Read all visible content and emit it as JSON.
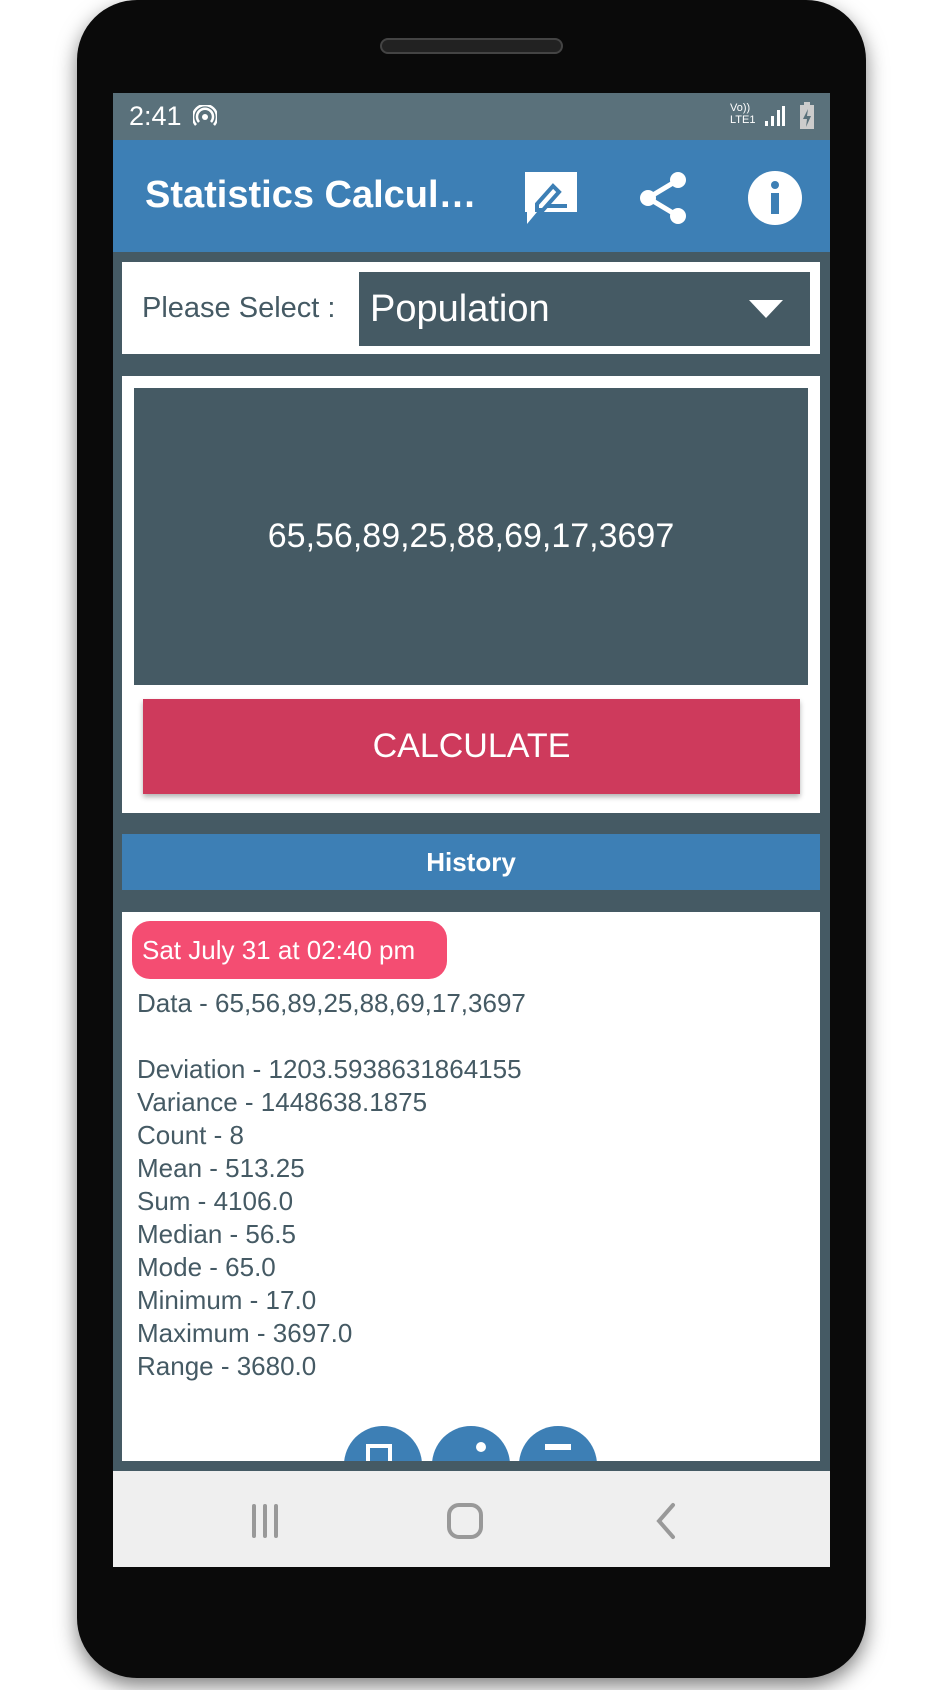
{
  "status_bar": {
    "time": "2:41",
    "network": "Vo)) LTE1"
  },
  "app_bar": {
    "title": "Statistics Calcul…",
    "icons": [
      "feedback-icon",
      "share-icon",
      "info-icon"
    ]
  },
  "selector": {
    "label": "Please Select :",
    "selected": "Population"
  },
  "input": {
    "value": "65,56,89,25,88,69,17,3697"
  },
  "calculate_label": "CALCULATE",
  "history": {
    "title": "History",
    "entry": {
      "timestamp": "Sat July 31 at 02:40 pm",
      "data": "Data - 65,56,89,25,88,69,17,3697",
      "stats": [
        "Deviation - 1203.5938631864155",
        "Variance - 1448638.1875",
        "Count - 8",
        "Mean - 513.25",
        "Sum - 4106.0",
        "Median - 56.5",
        "Mode - 65.0",
        "Minimum - 17.0",
        "Maximum - 3697.0",
        "Range - 3680.0"
      ]
    }
  },
  "colors": {
    "app_bar": "#3d7fb5",
    "calculate": "#ce3a5c",
    "pill": "#f44d72",
    "dark": "#455a64"
  }
}
